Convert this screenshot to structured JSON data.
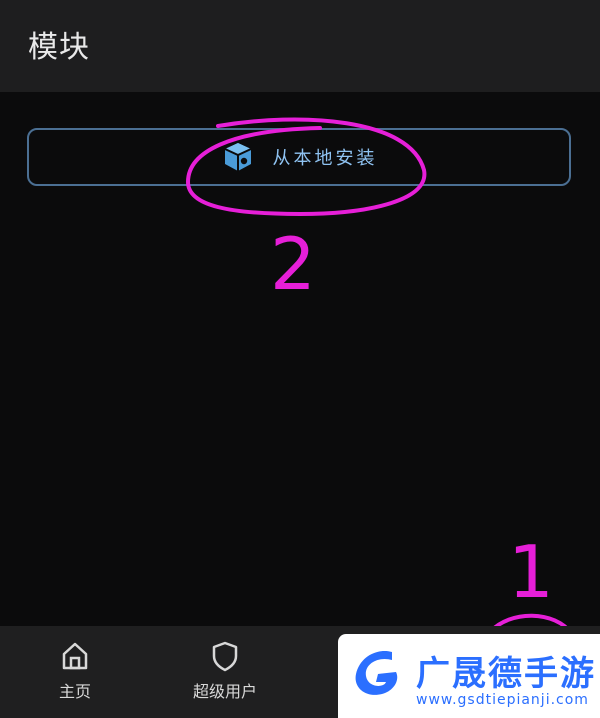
{
  "header": {
    "title": "模块"
  },
  "main": {
    "install_button": {
      "label": "从本地安装",
      "icon": "box-icon"
    }
  },
  "annotations": {
    "step_1": "1",
    "step_2": "2",
    "color": "#e61fd8"
  },
  "bottom_nav": {
    "items": [
      {
        "label": "主页",
        "icon": "home-icon"
      },
      {
        "label": "超级用户",
        "icon": "shield-icon"
      }
    ]
  },
  "watermark": {
    "title": "广晟德手游",
    "url": "www.gsdtiepianji.com"
  },
  "colors": {
    "accent": "#8fc3f2",
    "background": "#0b0b0c",
    "bar": "#1f1f20"
  }
}
